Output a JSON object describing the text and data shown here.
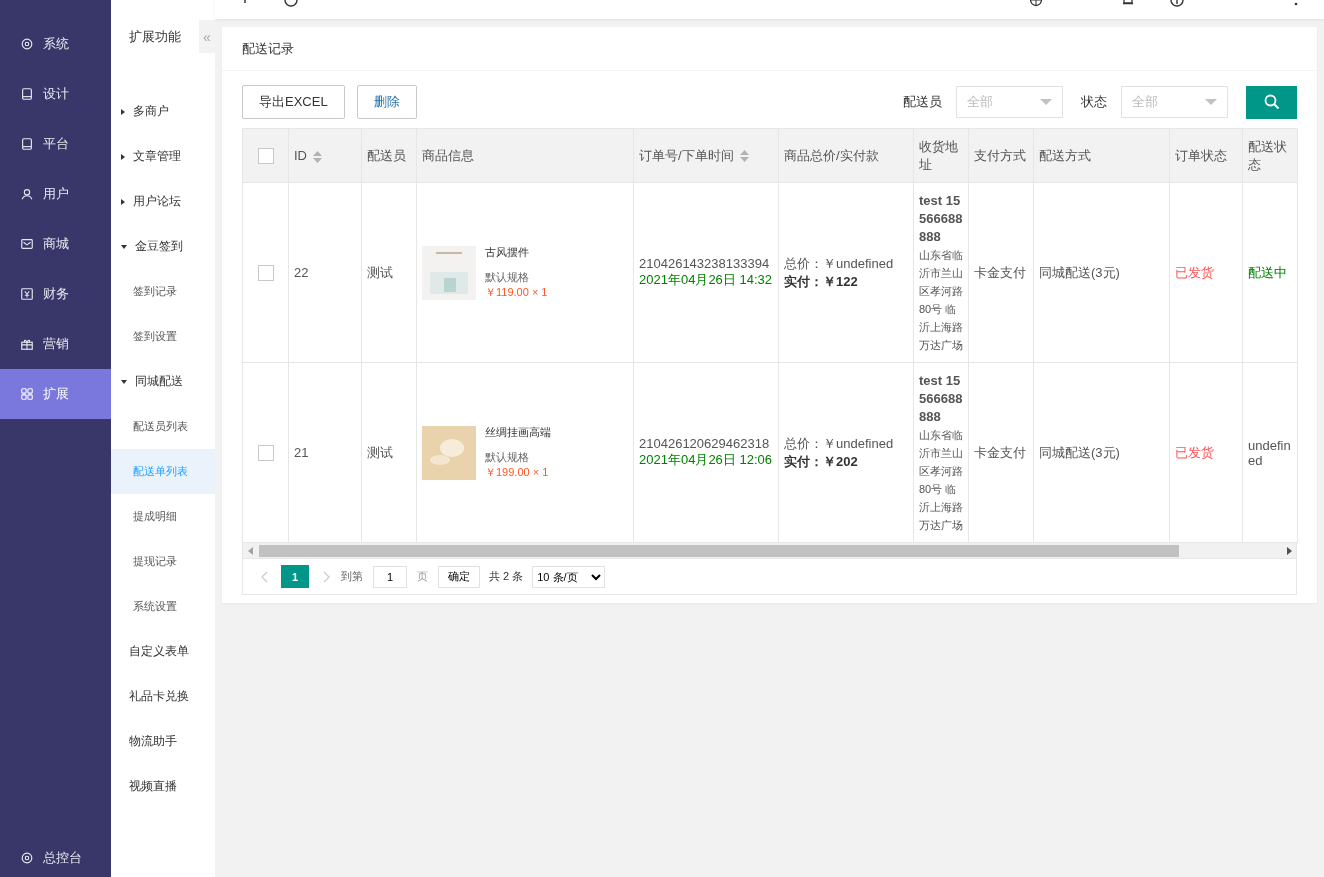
{
  "main_nav": {
    "items": [
      {
        "label": "系统",
        "selected": false
      },
      {
        "label": "设计",
        "selected": false
      },
      {
        "label": "平台",
        "selected": false
      },
      {
        "label": "用户",
        "selected": false
      },
      {
        "label": "商城",
        "selected": false
      },
      {
        "label": "财务",
        "selected": false
      },
      {
        "label": "营销",
        "selected": false
      },
      {
        "label": "扩展",
        "selected": true
      }
    ],
    "footer": {
      "label": "总控台"
    }
  },
  "sub_nav": {
    "title": "扩展功能",
    "collapse": "«",
    "items": [
      {
        "label": "多商户",
        "kind": "group",
        "expanded": false
      },
      {
        "label": "文章管理",
        "kind": "group",
        "expanded": false
      },
      {
        "label": "用户论坛",
        "kind": "group",
        "expanded": false
      },
      {
        "label": "金豆签到",
        "kind": "group",
        "expanded": true,
        "children": [
          {
            "label": "签到记录",
            "selected": false
          },
          {
            "label": "签到设置",
            "selected": false
          }
        ]
      },
      {
        "label": "同城配送",
        "kind": "group",
        "expanded": true,
        "children": [
          {
            "label": "配送员列表",
            "selected": false
          },
          {
            "label": "配送单列表",
            "selected": true
          },
          {
            "label": "提成明细",
            "selected": false
          },
          {
            "label": "提现记录",
            "selected": false
          },
          {
            "label": "系统设置",
            "selected": false
          }
        ]
      },
      {
        "label": "自定义表单",
        "kind": "link",
        "selected": false
      },
      {
        "label": "礼品卡兑换",
        "kind": "link",
        "selected": false
      },
      {
        "label": "物流助手",
        "kind": "link",
        "selected": false
      },
      {
        "label": "视频直播",
        "kind": "link",
        "selected": false
      }
    ]
  },
  "panel": {
    "title": "配送记录",
    "buttons": [
      "导出EXCEL",
      "删除"
    ],
    "filters": [
      {
        "label": "配送员",
        "placeholder": "全部"
      },
      {
        "label": "状态",
        "placeholder": "全部"
      }
    ],
    "table": {
      "columns": [
        {
          "kind": "checkbox",
          "checked": false
        },
        {
          "kind": "text",
          "label": "ID",
          "sortable": true
        },
        {
          "kind": "text",
          "label": "配送员",
          "sortable": false
        },
        {
          "kind": "text",
          "label": "商品信息",
          "sortable": false
        },
        {
          "kind": "text",
          "label": "订单号/下单时间",
          "sortable": true
        },
        {
          "kind": "text",
          "label": "商品总价/实付款",
          "sortable": false
        },
        {
          "kind": "text",
          "label": "收货地址",
          "sortable": false
        },
        {
          "kind": "text",
          "label": "支付方式",
          "sortable": false
        },
        {
          "kind": "text",
          "label": "配送方式",
          "sortable": false
        },
        {
          "kind": "text",
          "label": "订单状态",
          "sortable": false
        },
        {
          "kind": "text",
          "label": "配送状态",
          "sortable": false
        }
      ],
      "rows": [
        {
          "checked": false,
          "id": "22",
          "courier": "测试",
          "product": {
            "name": "古风摆件",
            "spec": "默认规格",
            "price": "￥119.00 × 1"
          },
          "order_no": "210426143238133394",
          "order_time": "2021年04月26日 14:32",
          "total": "总价：￥undefined",
          "paid": "实付：￥122",
          "contact": "test 15566688888",
          "address": "山东省临沂市兰山区孝河路80号 临沂上海路万达广场",
          "payment": "卡金支付",
          "delivery": "同城配送(3元)",
          "order_status": {
            "text": "已发货",
            "color": "#ff5555"
          },
          "delivery_status": {
            "text": "配送中",
            "color": "#008000"
          }
        },
        {
          "checked": false,
          "id": "21",
          "courier": "测试",
          "product": {
            "name": "丝绸挂画高端",
            "spec": "默认规格",
            "price": "￥199.00 × 1"
          },
          "order_no": "210426120629462318",
          "order_time": "2021年04月26日 12:06",
          "total": "总价：￥undefined",
          "paid": "实付：￥202",
          "contact": "test 15566688888",
          "address": "山东省临沂市兰山区孝河路80号 临沂上海路万达广场",
          "payment": "卡金支付",
          "delivery": "同城配送(3元)",
          "order_status": {
            "text": "已发货",
            "color": "#ff5555"
          },
          "delivery_status": {
            "text": "undefined",
            "color": "#555555"
          }
        }
      ]
    },
    "pagination": {
      "pages": [
        {
          "label": "1",
          "selected": true
        }
      ],
      "goto_label": "到第",
      "goto_value": "1",
      "page_unit": "页",
      "confirm": "确定",
      "total": "共 2 条",
      "page_size": "10 条/页"
    }
  }
}
